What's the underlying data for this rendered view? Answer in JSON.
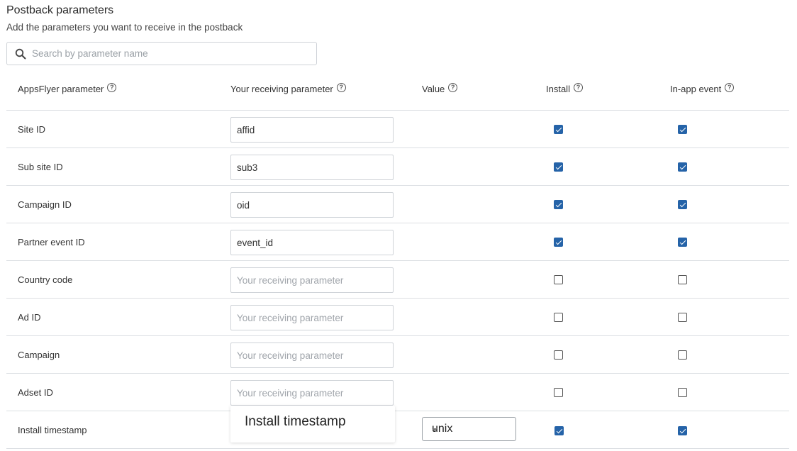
{
  "section": {
    "title": "Postback parameters",
    "subtitle": "Add the parameters you want to receive in the postback"
  },
  "search": {
    "placeholder": "Search by parameter name",
    "value": "",
    "icon": "search-icon"
  },
  "columns": {
    "appsflyer_param": "AppsFlyer parameter",
    "receiving_param": "Your receiving parameter",
    "value": "Value",
    "install": "Install",
    "inapp": "In-app event"
  },
  "field_placeholder": "Your receiving parameter",
  "rows": [
    {
      "label": "Site ID",
      "value": "affid",
      "install": true,
      "inapp": true
    },
    {
      "label": "Sub site ID",
      "value": "sub3",
      "install": true,
      "inapp": true
    },
    {
      "label": "Campaign ID",
      "value": "oid",
      "install": true,
      "inapp": true
    },
    {
      "label": "Partner event ID",
      "value": "event_id",
      "install": true,
      "inapp": true
    },
    {
      "label": "Country code",
      "value": "",
      "install": false,
      "inapp": false
    },
    {
      "label": "Ad ID",
      "value": "",
      "install": false,
      "inapp": false
    },
    {
      "label": "Campaign",
      "value": "",
      "install": false,
      "inapp": false
    },
    {
      "label": "Adset ID",
      "value": "",
      "install": false,
      "inapp": false
    },
    {
      "label": "Install timestamp",
      "tooltip": "Install timestamp",
      "select_value": "unix",
      "install": true,
      "inapp": true
    }
  ],
  "colors": {
    "accent": "#2563a8",
    "border": "#cfd3d8",
    "divider": "#dcdfe3"
  }
}
